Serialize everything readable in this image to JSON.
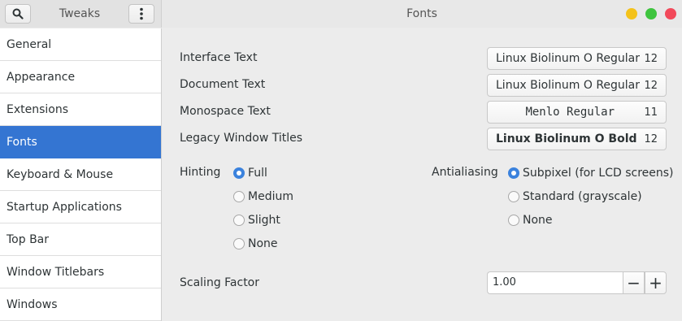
{
  "header": {
    "app_title": "Tweaks",
    "page_title": "Fonts",
    "search_icon": "search-icon",
    "menu_icon": "vertical-dots-icon"
  },
  "window_controls": {
    "minimize_color": "#f4c21a",
    "maximize_color": "#3ec43e",
    "close_color": "#f2495a"
  },
  "sidebar": {
    "active": "Fonts",
    "items": [
      {
        "label": "General"
      },
      {
        "label": "Appearance"
      },
      {
        "label": "Extensions"
      },
      {
        "label": "Fonts"
      },
      {
        "label": "Keyboard & Mouse"
      },
      {
        "label": "Startup Applications"
      },
      {
        "label": "Top Bar"
      },
      {
        "label": "Window Titlebars"
      },
      {
        "label": "Windows"
      }
    ]
  },
  "fonts": {
    "interface": {
      "label": "Interface Text",
      "font": "Linux Biolinum O Regular",
      "size": "12"
    },
    "document": {
      "label": "Document Text",
      "font": "Linux Biolinum O Regular",
      "size": "12"
    },
    "monospace": {
      "label": "Monospace Text",
      "font": "Menlo Regular",
      "size": "11"
    },
    "legacy": {
      "label": "Legacy Window Titles",
      "font": "Linux Biolinum O Bold",
      "size": "12"
    }
  },
  "hinting": {
    "label": "Hinting",
    "selected": "Full",
    "options": [
      "Full",
      "Medium",
      "Slight",
      "None"
    ]
  },
  "antialiasing": {
    "label": "Antialiasing",
    "selected": "Subpixel (for LCD screens)",
    "options": [
      "Subpixel (for LCD screens)",
      "Standard (grayscale)",
      "None"
    ]
  },
  "scaling": {
    "label": "Scaling Factor",
    "value": "1.00",
    "minus": "−",
    "plus": "+"
  },
  "colors": {
    "accent": "#3475d2",
    "radio_checked": "#3b82dd"
  }
}
